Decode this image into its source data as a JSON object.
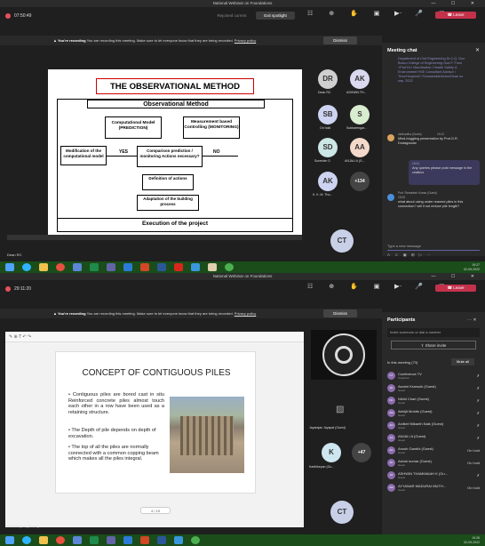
{
  "window_title": "National Webinar on Foundations",
  "top": {
    "timer": "07:50:49",
    "reopen_label": "Rejoined current",
    "spotlight_label": "Exit spotlight",
    "leave_label": "Leave",
    "banner": {
      "title": "You're recording",
      "text": "You are recording this meeting. Make sure to let everyone know that they are being recorded.",
      "link": "Privacy policy",
      "dismiss": "Dismiss"
    },
    "slide": {
      "title": "THE OBSERVATIONAL METHOD",
      "box_header": "Observational Method",
      "computational": "Computational Model (PREDICTION)",
      "measurement": "Measurement based Controlling (MONITORING)",
      "modification": "Modification of the computational model",
      "comparison": "Comparison prediction / monitoring Actions necessary?",
      "yes": "YES",
      "no": "NO",
      "definition": "Definition of actions",
      "adaptation": "Adaptation of the building process",
      "execution": "Execution of the project"
    },
    "participants": [
      {
        "initials": "DR",
        "name": "Dean RC",
        "color": "#cfcfcf"
      },
      {
        "initials": "AK",
        "name": "ASHWIN TH...",
        "color": "#d9d9ef"
      },
      {
        "initials": "SB",
        "name": "On hold",
        "color": "#cdd3f0"
      },
      {
        "initials": "S",
        "name": "Subbarengar...",
        "color": "#d8ecd0"
      },
      {
        "initials": "SD",
        "name": "Surender D",
        "color": "#cde6e6"
      },
      {
        "initials": "AA",
        "name": "ANJALI A (G...",
        "color": "#f3d9c9"
      },
      {
        "initials": "AK",
        "name": "K. K. M. Tho...",
        "color": "#cdd3f0"
      }
    ],
    "overflow_count": "+134",
    "self_initials": "CT",
    "presenter_name": "Dean RC",
    "chat": {
      "title": "Meeting chat",
      "msg1": "Department of Civil Engineering Dr.C.Q. Don Bosco College of Engineering Goa P. From +Prof Dr.I Mandhalkar / Health Safety & Environment HSE Consultant Advisor / Trivu/Hospira/0 /Tornadodistributor/Dean so sep. 2022",
      "msg2_author": "nirdhantha (Guest)",
      "msg2_time": "19:12",
      "msg2_text": "Mind-boggling presentation by Prof.G.R. Dodagoudar",
      "msg3_time": "19:24",
      "msg3_text": "Any queries please post message in the chatbox",
      "msg4_author": "Prof. Ramalesh Kumar (Guest)",
      "msg4_time": "19:26",
      "msg4_text": "what about using under reamed piles in this connection? will it not reduce pile length?",
      "input_placeholder": "Type a new message"
    },
    "clock": "19:27\n02-09-2022"
  },
  "bottom": {
    "timer": "29:11:20",
    "leave_label": "Leave",
    "banner": {
      "title": "You're recording",
      "text": "You are recording this meeting. Make sure to let everyone know that they are being recorded.",
      "link": "Privacy policy",
      "dismiss": "Dismiss"
    },
    "slide": {
      "title": "CONCEPT OF CONTIGUOUS PILES",
      "bullets": [
        "Contiguous piles are bored cast in situ Reinforced concrete piles almost touch each other in a row have been used as a retaining structure.",
        "The Depth of pile depends on depth of excavation.",
        "The top of all the piles are normally connected with a common copping beam which makes all the piles integral."
      ],
      "page": "4 / 19"
    },
    "tile_name": "Jayarajan Jayapal (Guest)",
    "k_initial": "K",
    "k_name": "Karthikeyan (Gu...",
    "overflow_count": "+47",
    "self_initials": "CT",
    "presenter_name": "Karthikeyan (Guest)",
    "panel": {
      "title": "Participants",
      "invite_placeholder": "Invite someone or dial a number",
      "share_invite": "Share invite",
      "in_meeting": "In this meeting (73)",
      "mute_all": "Mute all",
      "people": [
        {
          "initials": "CT",
          "name": "Conference TV",
          "role": "Organizer",
          "status": ""
        },
        {
          "initials": "AK",
          "name": "Asmini Ksmsulk (Guest)",
          "role": "Guest",
          "status": ""
        },
        {
          "initials": "NC",
          "name": "Nikhil Chari (Guest)",
          "role": "Guest",
          "status": ""
        },
        {
          "initials": "AM",
          "name": "Abhijit Mohite (Guest)",
          "role": "Guest",
          "status": ""
        },
        {
          "initials": "AN",
          "name": "Anilket Nilkanth Naik (Guest)",
          "role": "Guest",
          "status": ""
        },
        {
          "initials": "AA",
          "name": "ANJALI A (Guest)",
          "role": "Guest",
          "status": ""
        },
        {
          "initials": "AG",
          "name": "Anush Gandhi (Guest)",
          "role": "Guest",
          "status": "On hold"
        },
        {
          "initials": "AK",
          "name": "Ashok kumar (Guest)",
          "role": "Guest",
          "status": "On hold"
        },
        {
          "initials": "AT",
          "name": "ASHWIN THAMMAIAH K (Gu...",
          "role": "Guest",
          "status": ""
        },
        {
          "initials": "AM",
          "name": "AYYANAR MADURAI MUTH...",
          "role": "Guest",
          "status": "On hold"
        }
      ]
    },
    "clock": "19:28\n02-09-2022"
  }
}
